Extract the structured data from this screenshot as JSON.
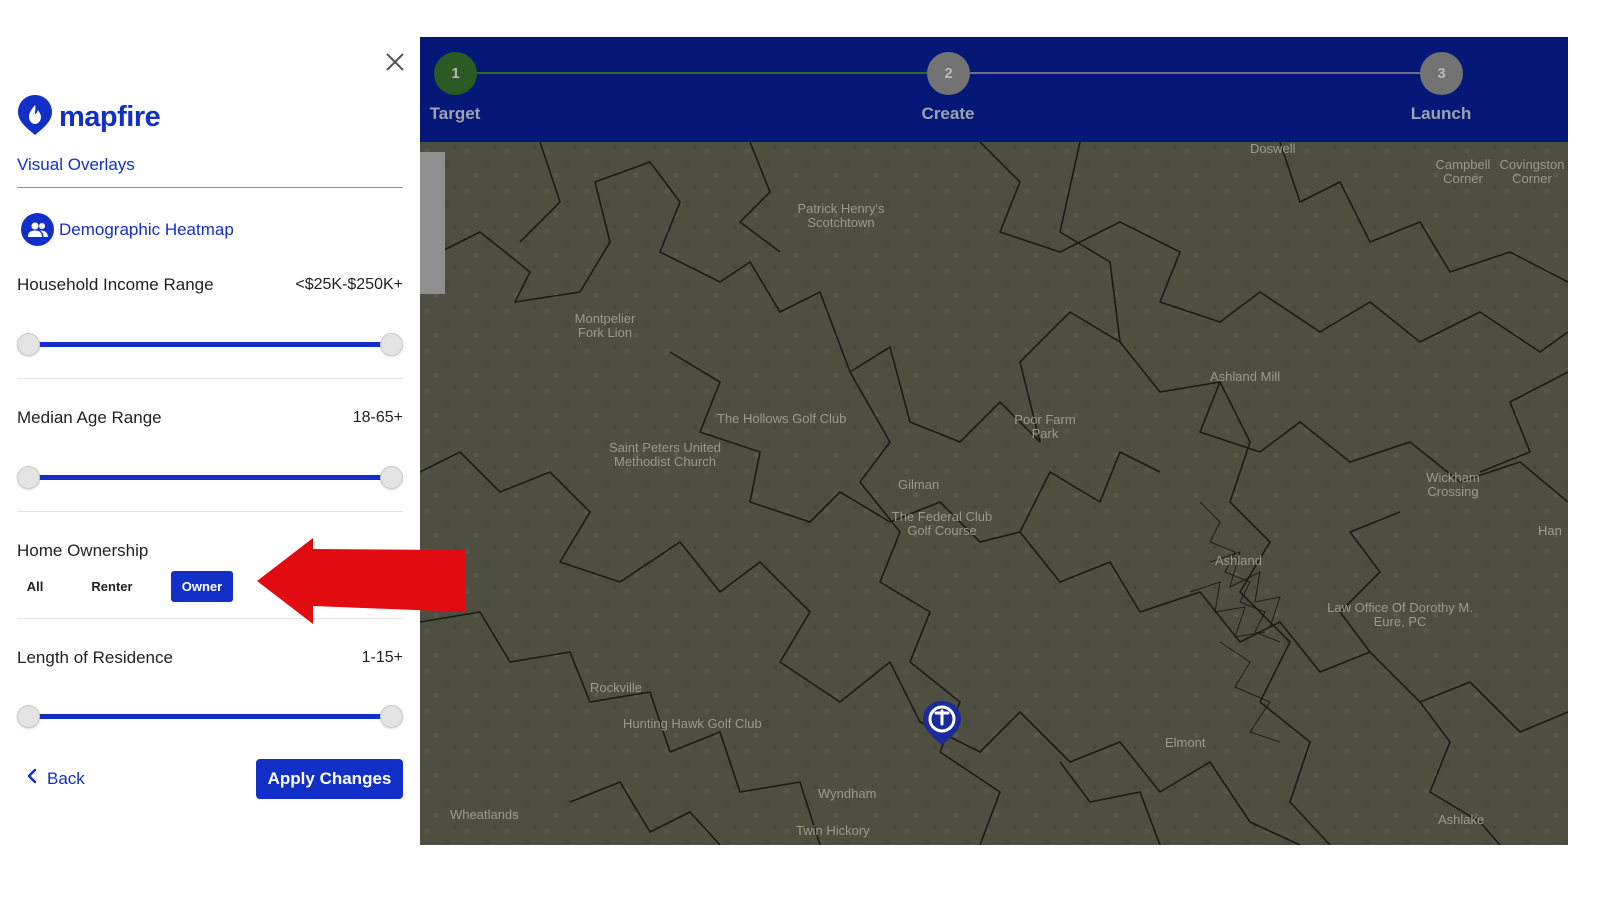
{
  "brand": {
    "name": "mapfire",
    "accent": "#1230c8"
  },
  "panel": {
    "section_title": "Visual Overlays",
    "overlay_label": "Demographic Heatmap",
    "filters": {
      "income": {
        "label": "Household Income Range",
        "value": "<$25K-$250K+"
      },
      "age": {
        "label": "Median Age Range",
        "value": "18-65+"
      },
      "ownership": {
        "label": "Home Ownership",
        "options": [
          "All",
          "Renter",
          "Owner"
        ],
        "selected": "Owner"
      },
      "residence": {
        "label": "Length of Residence",
        "value": "1-15+"
      }
    },
    "back_label": "Back",
    "apply_label": "Apply Changes"
  },
  "stepper": {
    "steps": [
      {
        "number": "1",
        "label": "Target",
        "status": "active"
      },
      {
        "number": "2",
        "label": "Create",
        "status": "pending"
      },
      {
        "number": "3",
        "label": "Launch",
        "status": "pending"
      }
    ]
  },
  "map": {
    "places": [
      "Doswell",
      "Campbell Corner",
      "Covingston Corner",
      "Patrick Henry's Scotchtown",
      "Montpelier Fork Lion",
      "Ashland Mill",
      "Poor Farm Park",
      "The Hollows Golf Club",
      "Saint Peters United Methodist Church",
      "Gilman",
      "Wickham Crossing",
      "The Federal Club Golf Course",
      "Ashland",
      "Law Office Of Dorothy M. Eure, PC",
      "Rockville",
      "Hunting Hawk Golf Club",
      "Elmont",
      "Wyndham",
      "Wheatlands",
      "Twin Hickory",
      "Ashlake",
      "Han"
    ]
  },
  "icons": [
    "close-icon",
    "mapfire-logo-icon",
    "people-icon",
    "chevron-left-icon",
    "location-pin-icon"
  ]
}
